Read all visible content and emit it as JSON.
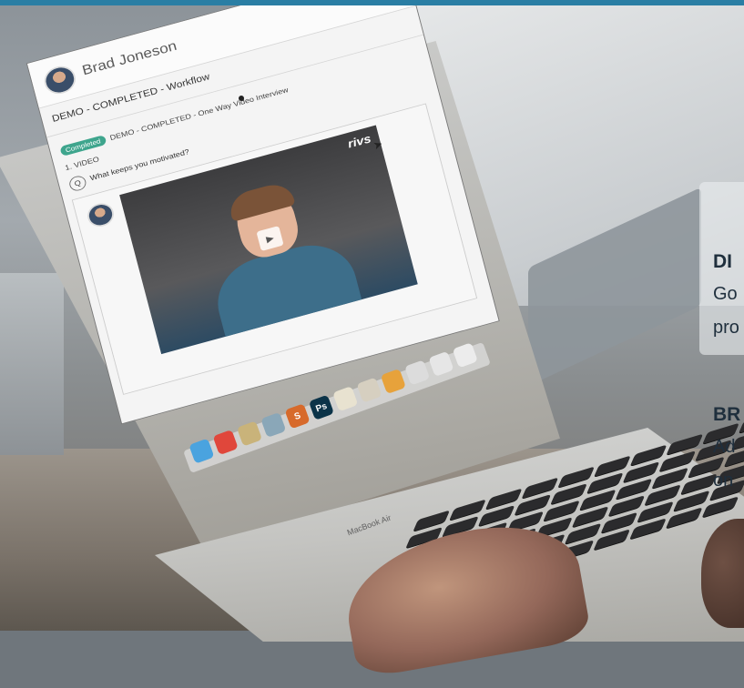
{
  "topbar_color": "#2a7ea4",
  "app": {
    "user_name": "Brad Joneson",
    "workflow_title": "DEMO - COMPLETED - Workflow",
    "status_badge": "Completed",
    "interview_title": "DEMO - COMPLETED - One Way Video Interview",
    "section_label": "1. VIDEO",
    "question_marker": "Q",
    "question_text": "What keeps you motivated?",
    "video_logo": "rivs",
    "play_icon": "play-icon"
  },
  "laptop": {
    "brand_label": "MacBook Air",
    "dock_icons": [
      {
        "name": "finder-icon",
        "label": "",
        "color": "#4aa3df"
      },
      {
        "name": "chrome-icon",
        "label": "",
        "color": "#e0473b"
      },
      {
        "name": "app-icon",
        "label": "",
        "color": "#c9b37a"
      },
      {
        "name": "app-icon",
        "label": "",
        "color": "#8aa7b8"
      },
      {
        "name": "app-icon",
        "label": "S",
        "color": "#d76a2b"
      },
      {
        "name": "photoshop-icon",
        "label": "Ps",
        "color": "#0b3348"
      },
      {
        "name": "app-icon",
        "label": "",
        "color": "#e8e2d0"
      },
      {
        "name": "app-icon",
        "label": "",
        "color": "#d6cfc0"
      },
      {
        "name": "app-icon",
        "label": "",
        "color": "#e7a23b"
      },
      {
        "name": "app-icon",
        "label": "",
        "color": "#dcdcdc"
      },
      {
        "name": "app-icon",
        "label": "",
        "color": "#e6e6e6"
      },
      {
        "name": "app-icon",
        "label": "",
        "color": "#ececec"
      }
    ]
  },
  "side_panel": {
    "heading_1": "DI",
    "line_1a": "Go",
    "line_1b": "pro",
    "heading_2": "BR",
    "line_2a": "Ad",
    "line_2b": "on"
  }
}
